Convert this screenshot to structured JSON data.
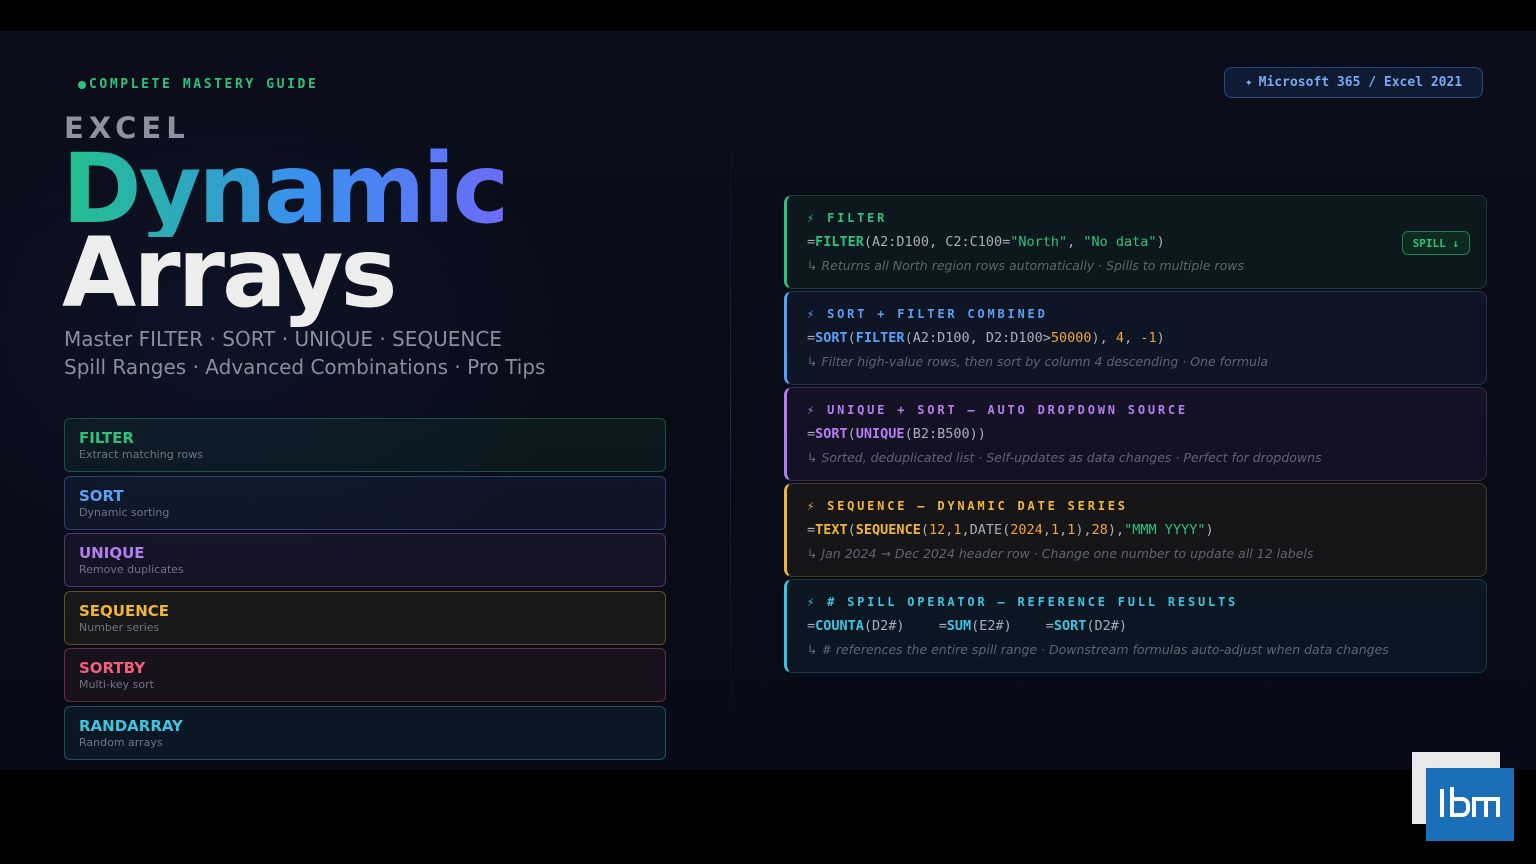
{
  "kicker": "COMPLETE MASTERY GUIDE",
  "eyebrow": "EXCEL",
  "title_line1": "Dynamic",
  "title_line2": "Arrays",
  "subtitle_line1": "Master FILTER · SORT · UNIQUE · SEQUENCE",
  "subtitle_line2": "Spill Ranges · Advanced Combinations · Pro Tips",
  "badge": {
    "icon": "sparkle-icon",
    "label": "Microsoft 365 / Excel 2021"
  },
  "functions": [
    {
      "name": "FILTER",
      "desc": "Extract matching rows",
      "color": "#2ec27e"
    },
    {
      "name": "SORT",
      "desc": "Dynamic sorting",
      "color": "#5aa0f5"
    },
    {
      "name": "UNIQUE",
      "desc": "Remove duplicates",
      "color": "#b77ef2"
    },
    {
      "name": "SEQUENCE",
      "desc": "Number series",
      "color": "#f2b632"
    },
    {
      "name": "SORTBY",
      "desc": "Multi-key sort",
      "color": "#f2607a"
    },
    {
      "name": "RANDARRAY",
      "desc": "Random arrays",
      "color": "#3cc4e0"
    }
  ],
  "cards": [
    {
      "icon": "lightning-icon",
      "title": "FILTER",
      "color": "#2ec27e",
      "formula_parts": [
        {
          "t": "=",
          "c": "plain"
        },
        {
          "t": "FILTER",
          "c": "fn"
        },
        {
          "t": "(A2:D100, C2:C100=",
          "c": "plain"
        },
        {
          "t": "\"North\"",
          "c": "str"
        },
        {
          "t": ", ",
          "c": "plain"
        },
        {
          "t": "\"No data\"",
          "c": "str"
        },
        {
          "t": ")",
          "c": "plain"
        }
      ],
      "desc": "↳ Returns all North region rows automatically · Spills to multiple rows",
      "tag": "SPILL ↓"
    },
    {
      "icon": "lightning-icon",
      "title": "SORT + FILTER COMBINED",
      "color": "#5aa0f5",
      "formula_parts": [
        {
          "t": "=",
          "c": "plain"
        },
        {
          "t": "SORT",
          "c": "fn"
        },
        {
          "t": "(",
          "c": "plain"
        },
        {
          "t": "FILTER",
          "c": "fn"
        },
        {
          "t": "(A2:D100, D2:D100>",
          "c": "plain"
        },
        {
          "t": "50000",
          "c": "num"
        },
        {
          "t": "), ",
          "c": "plain"
        },
        {
          "t": "4",
          "c": "num"
        },
        {
          "t": ", ",
          "c": "plain"
        },
        {
          "t": "-1",
          "c": "num"
        },
        {
          "t": ")",
          "c": "plain"
        }
      ],
      "desc": "↳ Filter high-value rows, then sort by column 4 descending · One formula"
    },
    {
      "icon": "lightning-icon",
      "title": "UNIQUE + SORT — AUTO DROPDOWN SOURCE",
      "color": "#b77ef2",
      "formula_parts": [
        {
          "t": "=",
          "c": "plain"
        },
        {
          "t": "SORT",
          "c": "fn"
        },
        {
          "t": "(",
          "c": "plain"
        },
        {
          "t": "UNIQUE",
          "c": "fn"
        },
        {
          "t": "(B2:B500))",
          "c": "plain"
        }
      ],
      "desc": "↳ Sorted, deduplicated list · Self-updates as data changes · Perfect for dropdowns"
    },
    {
      "icon": "lightning-icon",
      "title": "SEQUENCE — DYNAMIC DATE SERIES",
      "color": "#f2b632",
      "formula_parts": [
        {
          "t": "=",
          "c": "plain"
        },
        {
          "t": "TEXT",
          "c": "fn"
        },
        {
          "t": "(",
          "c": "plain"
        },
        {
          "t": "SEQUENCE",
          "c": "fn"
        },
        {
          "t": "(",
          "c": "plain"
        },
        {
          "t": "12",
          "c": "num"
        },
        {
          "t": ",",
          "c": "plain"
        },
        {
          "t": "1",
          "c": "num"
        },
        {
          "t": ",DATE(",
          "c": "plain"
        },
        {
          "t": "2024",
          "c": "num"
        },
        {
          "t": ",",
          "c": "plain"
        },
        {
          "t": "1",
          "c": "num"
        },
        {
          "t": ",",
          "c": "plain"
        },
        {
          "t": "1",
          "c": "num"
        },
        {
          "t": "),",
          "c": "plain"
        },
        {
          "t": "28",
          "c": "num"
        },
        {
          "t": "),",
          "c": "plain"
        },
        {
          "t": "\"MMM YYYY\"",
          "c": "str"
        },
        {
          "t": ")",
          "c": "plain"
        }
      ],
      "desc": "↳ Jan 2024 → Dec 2024 header row · Change one number to update all 12 labels"
    },
    {
      "icon": "lightning-icon",
      "title": "# SPILL OPERATOR — REFERENCE FULL RESULTS",
      "color": "#3cc4e0",
      "formula_parts": [
        {
          "t": "=",
          "c": "plain"
        },
        {
          "t": "COUNTA",
          "c": "fn"
        },
        {
          "t": "(D2#)",
          "c": "plain"
        },
        {
          "t": "",
          "c": "gap"
        },
        {
          "t": "=",
          "c": "plain"
        },
        {
          "t": "SUM",
          "c": "fn"
        },
        {
          "t": "(E2#)",
          "c": "plain"
        },
        {
          "t": "",
          "c": "gap"
        },
        {
          "t": "=",
          "c": "plain"
        },
        {
          "t": "SORT",
          "c": "fn"
        },
        {
          "t": "(D2#)",
          "c": "plain"
        }
      ],
      "desc": "↳ # references the entire spill range · Downstream formulas auto-adjust when data changes"
    }
  ],
  "colors": {
    "string": "#2ec27e",
    "number": "#f2a33c"
  },
  "logo": {
    "text": "ibm"
  }
}
